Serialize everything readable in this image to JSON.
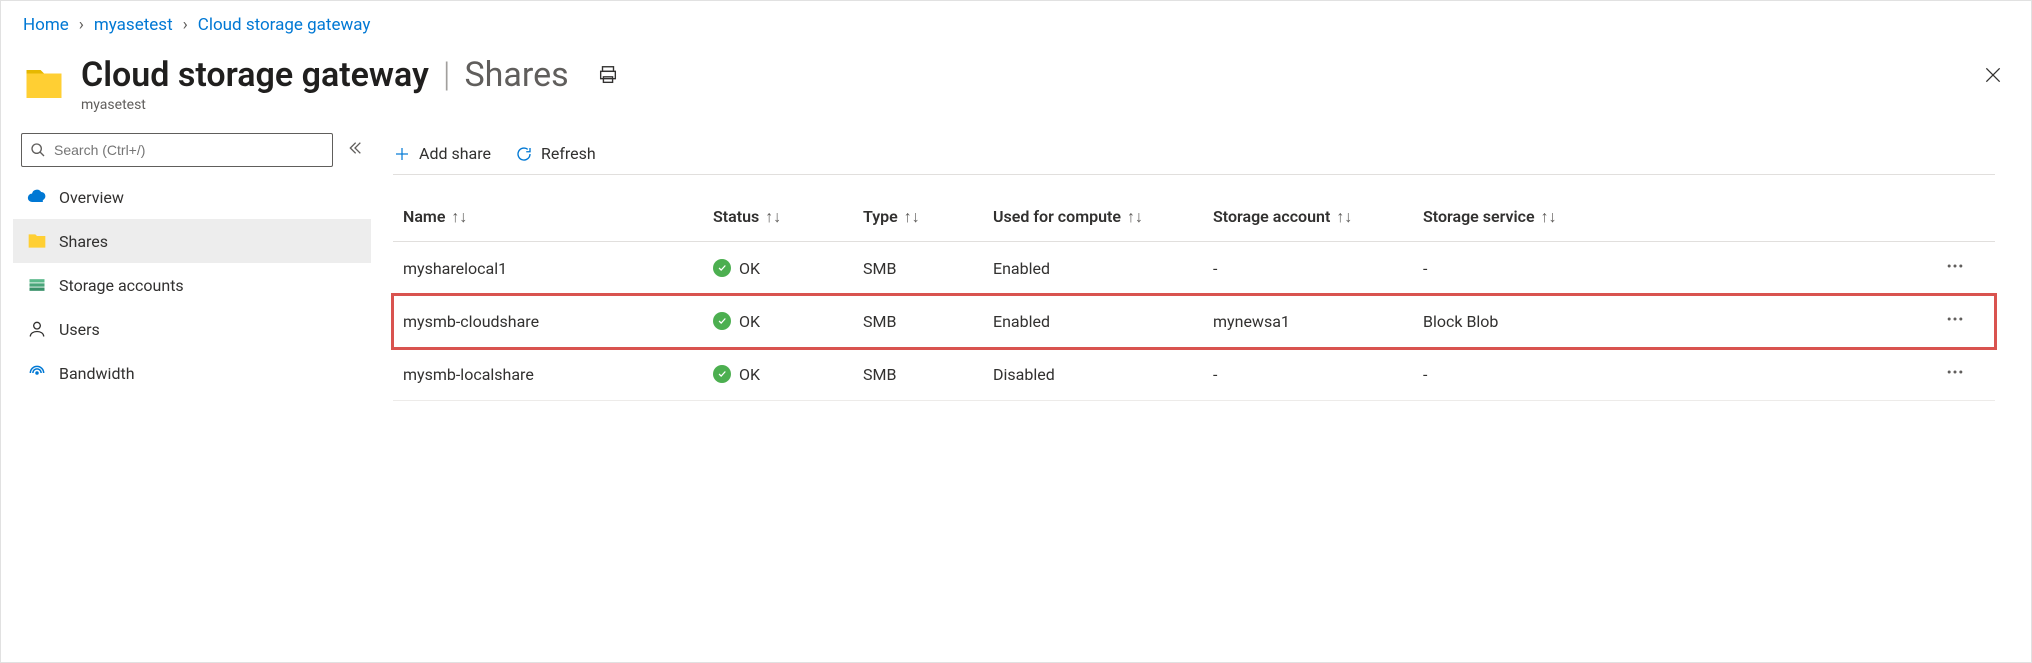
{
  "breadcrumb": {
    "home": "Home",
    "resource": "myasetest",
    "page": "Cloud storage gateway"
  },
  "header": {
    "title": "Cloud storage gateway",
    "section": "Shares",
    "resource_name": "myasetest"
  },
  "sidebar": {
    "search_placeholder": "Search (Ctrl+/)",
    "items": [
      {
        "label": "Overview"
      },
      {
        "label": "Shares"
      },
      {
        "label": "Storage accounts"
      },
      {
        "label": "Users"
      },
      {
        "label": "Bandwidth"
      }
    ]
  },
  "toolbar": {
    "add_share": "Add share",
    "refresh": "Refresh"
  },
  "table": {
    "columns": {
      "name": "Name",
      "status": "Status",
      "type": "Type",
      "compute": "Used for compute",
      "account": "Storage account",
      "service": "Storage service"
    },
    "rows": [
      {
        "name": "mysharelocal1",
        "status": "OK",
        "type": "SMB",
        "compute": "Enabled",
        "account": "-",
        "service": "-"
      },
      {
        "name": "mysmb-cloudshare",
        "status": "OK",
        "type": "SMB",
        "compute": "Enabled",
        "account": "mynewsa1",
        "service": "Block Blob",
        "highlighted": true
      },
      {
        "name": "mysmb-localshare",
        "status": "OK",
        "type": "SMB",
        "compute": "Disabled",
        "account": "-",
        "service": "-"
      }
    ]
  }
}
